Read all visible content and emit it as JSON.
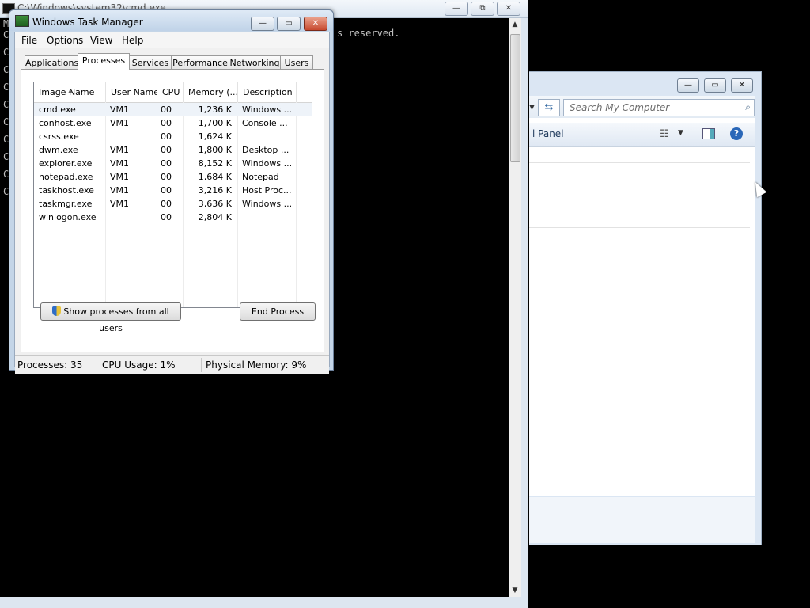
{
  "cmd": {
    "title": "C:\\Windows\\system32\\cmd.exe",
    "reserved_text": "s reserved.",
    "left_chars": [
      "M",
      "C",
      "C",
      "C",
      "C",
      "C",
      "C",
      "C",
      "C",
      "C",
      "C"
    ],
    "buttons": {
      "minimize": "—",
      "restore": "⧉",
      "close": "✕"
    }
  },
  "explorer": {
    "search_placeholder": "Search My Computer",
    "toolbar_label": "l Panel",
    "buttons": {
      "minimize": "—",
      "restore": "▭",
      "close": "✕"
    },
    "refresh_glyph": "⇆",
    "search_glyph": "⌕",
    "views_glyph": "☷",
    "help_glyph": "?"
  },
  "taskmgr": {
    "title": "Windows Task Manager",
    "buttons": {
      "minimize": "—",
      "restore": "▭",
      "close": "✕"
    },
    "menu": [
      "File",
      "Options",
      "View",
      "Help"
    ],
    "tabs": [
      "Applications",
      "Processes",
      "Services",
      "Performance",
      "Networking",
      "Users"
    ],
    "active_tab": "Processes",
    "columns": [
      "Image Name",
      "User Name",
      "CPU",
      "Memory (...",
      "Description"
    ],
    "rows": [
      {
        "name": "cmd.exe",
        "user": "VM1",
        "cpu": "00",
        "mem": "1,236 K",
        "desc": "Windows ..."
      },
      {
        "name": "conhost.exe",
        "user": "VM1",
        "cpu": "00",
        "mem": "1,700 K",
        "desc": "Console ..."
      },
      {
        "name": "csrss.exe",
        "user": "",
        "cpu": "00",
        "mem": "1,624 K",
        "desc": ""
      },
      {
        "name": "dwm.exe",
        "user": "VM1",
        "cpu": "00",
        "mem": "1,800 K",
        "desc": "Desktop ..."
      },
      {
        "name": "explorer.exe",
        "user": "VM1",
        "cpu": "00",
        "mem": "8,152 K",
        "desc": "Windows ..."
      },
      {
        "name": "notepad.exe",
        "user": "VM1",
        "cpu": "00",
        "mem": "1,684 K",
        "desc": "Notepad"
      },
      {
        "name": "taskhost.exe",
        "user": "VM1",
        "cpu": "00",
        "mem": "3,216 K",
        "desc": "Host Proc..."
      },
      {
        "name": "taskmgr.exe",
        "user": "VM1",
        "cpu": "00",
        "mem": "3,636 K",
        "desc": "Windows ..."
      },
      {
        "name": "winlogon.exe",
        "user": "",
        "cpu": "00",
        "mem": "2,804 K",
        "desc": ""
      }
    ],
    "show_all_label": "Show processes from all users",
    "end_process_label": "End Process",
    "status": {
      "processes": "Processes: 35",
      "cpu": "CPU Usage: 1%",
      "memory": "Physical Memory: 9%"
    }
  }
}
